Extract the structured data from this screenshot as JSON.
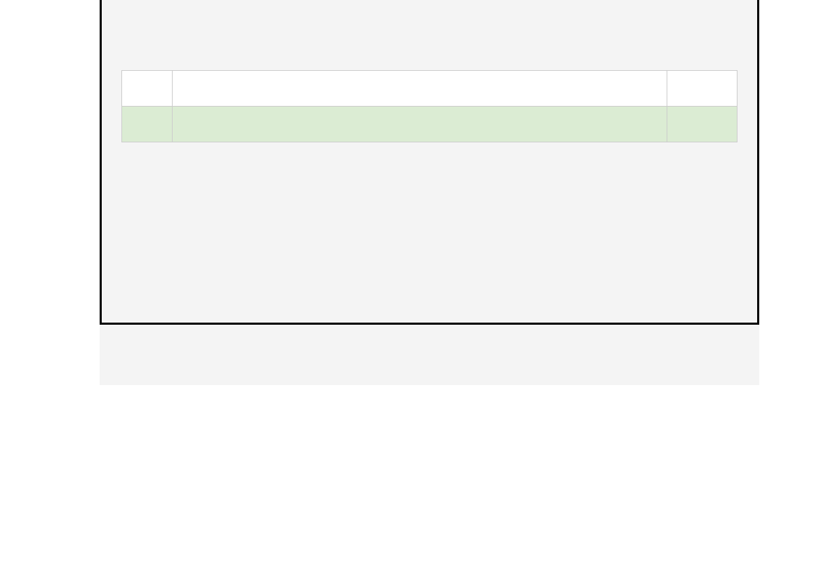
{
  "table": {
    "rows": [
      {
        "col1": "",
        "col2": "",
        "col3": ""
      },
      {
        "col1": "",
        "col2": "",
        "col3": ""
      }
    ]
  }
}
